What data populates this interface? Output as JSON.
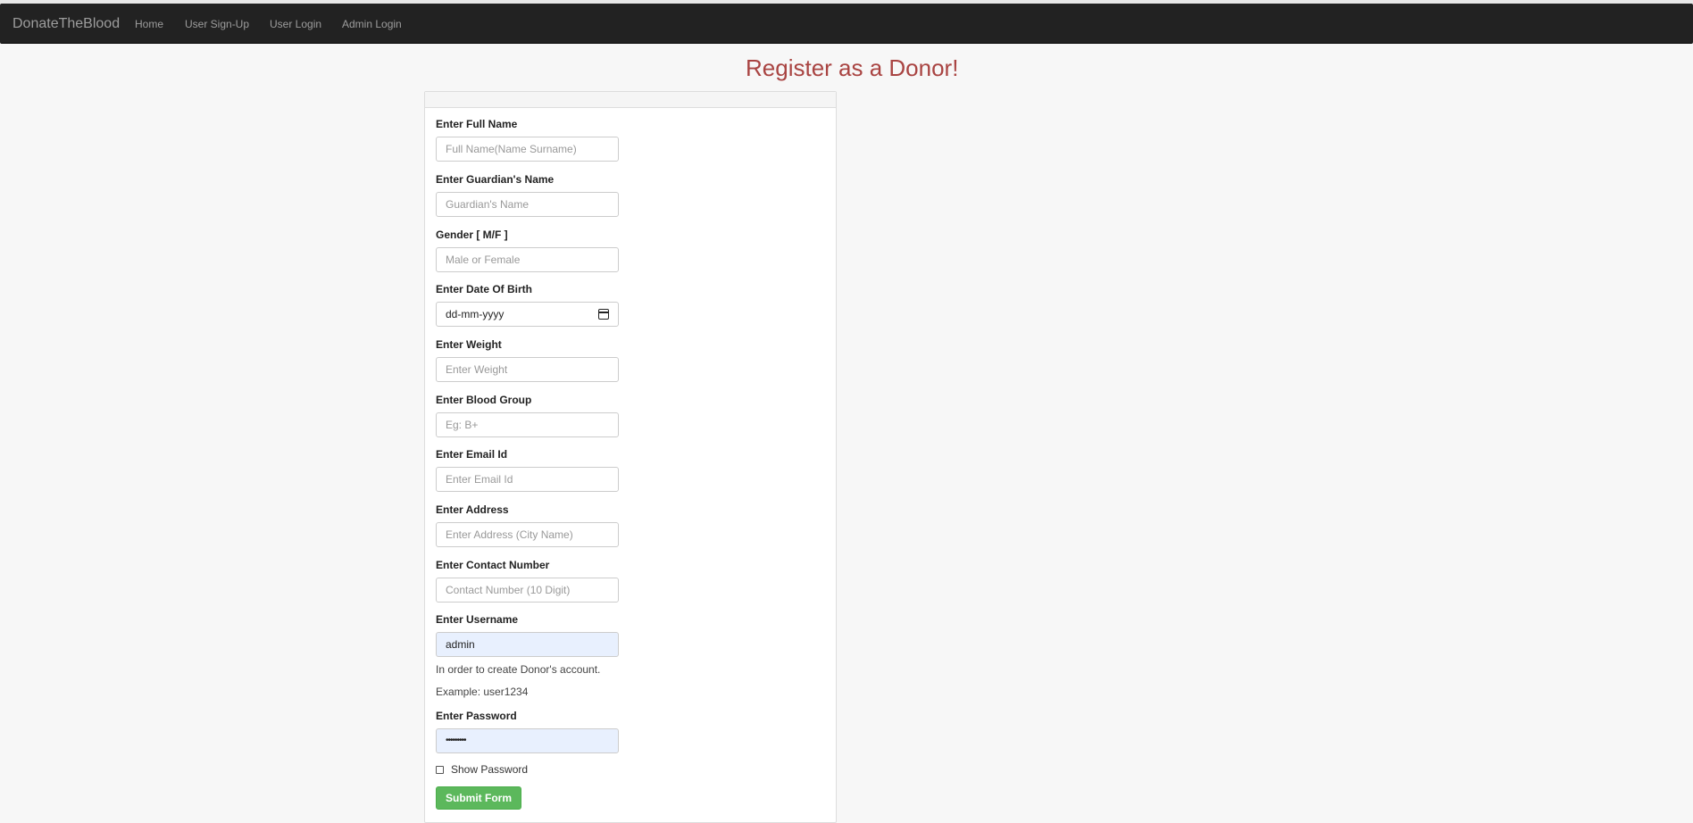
{
  "navbar": {
    "brand": "DonateTheBlood",
    "links": [
      "Home",
      "User Sign-Up",
      "User Login",
      "Admin Login"
    ]
  },
  "page": {
    "title": "Register as a Donor!"
  },
  "form": {
    "fields": [
      {
        "label": "Enter Full Name",
        "placeholder": "Full Name(Name Surname)",
        "value": ""
      },
      {
        "label": "Enter Guardian's Name",
        "placeholder": "Guardian's Name",
        "value": ""
      },
      {
        "label": "Gender [ M/F ]",
        "placeholder": "Male or Female",
        "value": ""
      },
      {
        "label": "Enter Date Of Birth",
        "placeholder": "dd-mm-yyyy",
        "value": ""
      },
      {
        "label": "Enter Weight",
        "placeholder": "Enter Weight",
        "value": ""
      },
      {
        "label": "Enter Blood Group",
        "placeholder": "Eg: B+",
        "value": ""
      },
      {
        "label": "Enter Email Id",
        "placeholder": "Enter Email Id",
        "value": ""
      },
      {
        "label": "Enter Address",
        "placeholder": "Enter Address (City Name)",
        "value": ""
      },
      {
        "label": "Enter Contact Number",
        "placeholder": "Contact Number (10 Digit)",
        "value": ""
      },
      {
        "label": "Enter Username",
        "placeholder": "",
        "value": "admin"
      },
      {
        "label": "Enter Password",
        "placeholder": "",
        "value": "•••••••••"
      }
    ],
    "username_help": [
      "In order to create Donor's account.",
      "Example: user1234"
    ],
    "show_password_label": "Show Password",
    "submit_label": "Submit Form"
  },
  "colors": {
    "navbar_bg": "#222222",
    "title": "#a94442",
    "submit_bg": "#5cb85c",
    "autofill_bg": "#e8f0fe"
  }
}
